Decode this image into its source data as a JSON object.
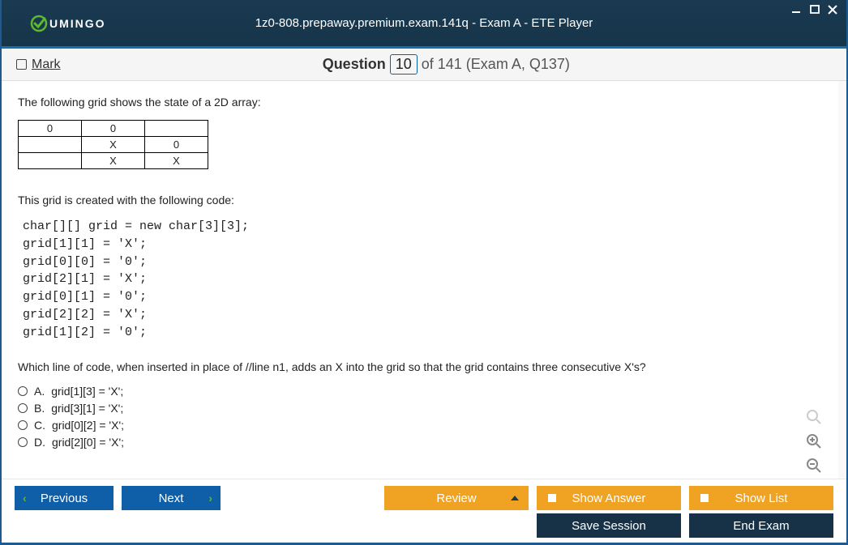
{
  "window": {
    "title": "1z0-808.prepaway.premium.exam.141q - Exam A - ETE Player",
    "brand": "UMINGO"
  },
  "header": {
    "mark_label": "Mark",
    "q_word": "Question",
    "q_current": "10",
    "q_total_and_ref": "of 141 (Exam A, Q137)"
  },
  "content": {
    "intro1": "The following grid shows the state of a 2D array:",
    "grid": [
      [
        "0",
        "0",
        ""
      ],
      [
        "",
        "X",
        "0"
      ],
      [
        "",
        "X",
        "X"
      ]
    ],
    "intro2": "This grid is created with the following code:",
    "code": "char[][] grid = new char[3][3];\ngrid[1][1] = 'X';\ngrid[0][0] = '0';\ngrid[2][1] = 'X';\ngrid[0][1] = '0';\ngrid[2][2] = 'X';\ngrid[1][2] = '0';",
    "question_text": "Which line of code, when inserted in place of //line n1, adds an X into the grid so that the grid contains three consecutive X's?",
    "options": [
      {
        "letter": "A.",
        "text": "grid[1][3] = 'X';"
      },
      {
        "letter": "B.",
        "text": "grid[3][1] = 'X';"
      },
      {
        "letter": "C.",
        "text": "grid[0][2] = 'X';"
      },
      {
        "letter": "D.",
        "text": "grid[2][0] = 'X';"
      }
    ]
  },
  "buttons": {
    "previous": "Previous",
    "next": "Next",
    "review": "Review",
    "show_answer": "Show Answer",
    "show_list": "Show List",
    "save_session": "Save Session",
    "end_exam": "End Exam"
  }
}
